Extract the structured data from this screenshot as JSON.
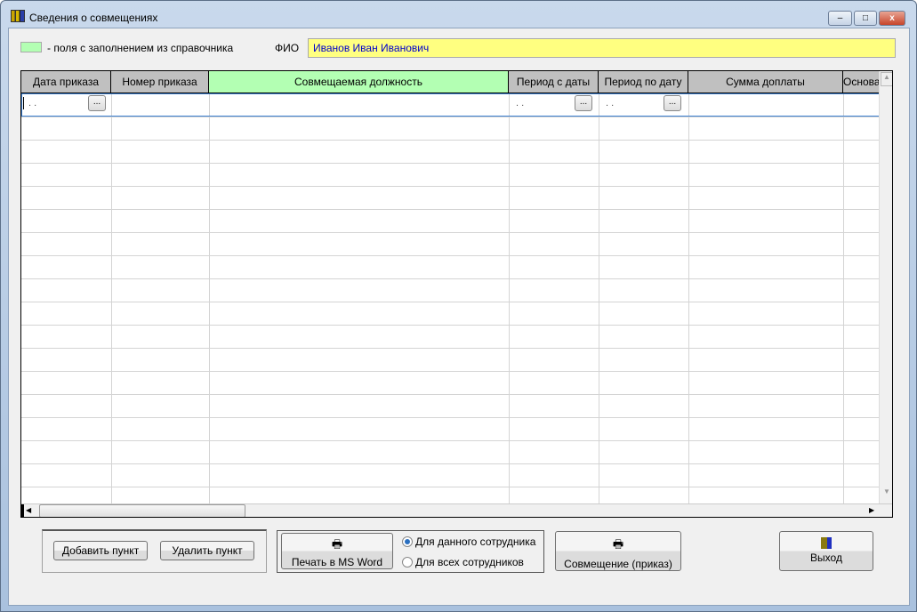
{
  "window": {
    "title": "Сведения о совмещениях",
    "minimize": "–",
    "maximize": "□",
    "close": "x"
  },
  "legend": {
    "text": "- поля с заполнением из справочника",
    "color": "#b3ffb3"
  },
  "fio": {
    "label": "ФИО",
    "value": "Иванов Иван Иванович"
  },
  "grid": {
    "columns": [
      "Дата приказа",
      "Номер приказа",
      "Совмещаемая должность",
      "Период с даты",
      "Период по дату",
      "Сумма доплаты",
      "Основа"
    ],
    "first_row": {
      "date_order": ". .",
      "period_from": ". .",
      "period_to": ". .",
      "picker": "..."
    }
  },
  "buttons": {
    "add": "Добавить пункт",
    "delete": "Удалить пункт",
    "print_word": "Печать в MS Word",
    "combo_order": "Совмещение (приказ)",
    "exit": "Выход"
  },
  "radios": {
    "this_employee": "Для данного сотрудника",
    "all_employees": "Для всех сотрудников"
  }
}
